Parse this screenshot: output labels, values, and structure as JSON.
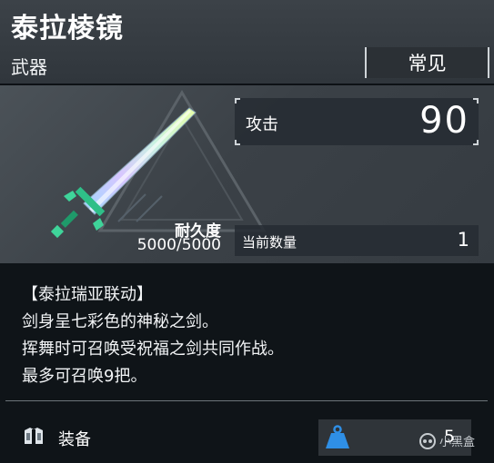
{
  "item": {
    "name": "泰拉棱镜",
    "category": "武器",
    "rarity": "常见"
  },
  "durability": {
    "label": "耐久度",
    "value": "5000/5000"
  },
  "stats": {
    "attack_label": "攻击",
    "attack_value": "90",
    "count_label": "当前数量",
    "count_value": "1"
  },
  "description": {
    "line1": "【泰拉瑞亚联动】",
    "line2": "剑身呈七彩色的神秘之剑。",
    "line3": "挥舞时可召唤受祝福之剑共同作战。",
    "line4": "最多可召唤9把。"
  },
  "footer": {
    "equip_label": "装备",
    "weight_value": "5"
  },
  "watermark": {
    "text": "小黑盒"
  },
  "icons": {
    "sword": "sword-icon",
    "equip": "equip-icon",
    "weight": "weight-icon",
    "watermark": "heybox-logo"
  },
  "colors": {
    "header_bg": "#3c4248",
    "panel_bg": "#0f1418",
    "weight_icon": "#2f8fe6",
    "sword_hilt": "#3fd49a"
  }
}
